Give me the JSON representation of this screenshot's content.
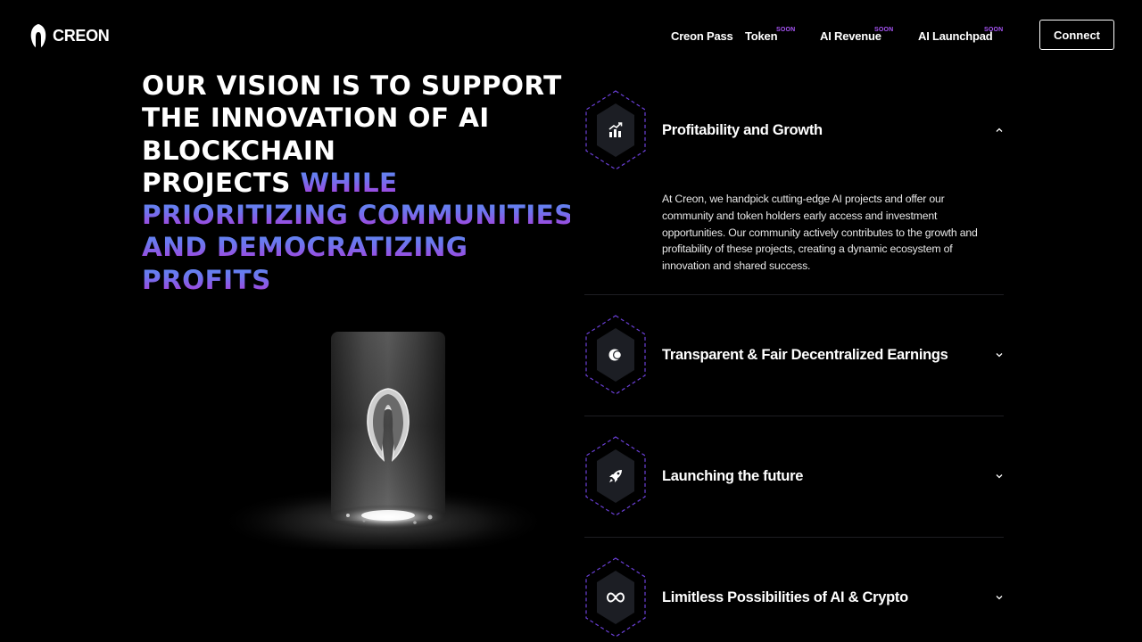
{
  "brand": {
    "name": "CREON"
  },
  "nav": {
    "items": [
      {
        "label": "Creon Pass",
        "badge": ""
      },
      {
        "label": "Token",
        "badge": "SOON"
      },
      {
        "label": "AI Revenue",
        "badge": "SOON"
      },
      {
        "label": "AI Launchpad",
        "badge": "SOON"
      }
    ],
    "connect_label": "Connect"
  },
  "headline": {
    "lines_white": [
      "OUR VISION IS TO SUPPORT",
      "THE INNOVATION OF AI",
      "BLOCKCHAIN",
      "PROJECTS"
    ],
    "highlight_inline": "WHILE",
    "lines_highlight": [
      "PRIORITIZING COMMUNITIES",
      "AND DEMOCRATIZING",
      "PROFITS"
    ]
  },
  "accordion": {
    "items": [
      {
        "title": "Profitability and Growth",
        "icon": "chart-growth-icon",
        "expanded": true,
        "body": "At Creon, we handpick cutting-edge AI projects and offer our community and token holders early access and investment opportunities. Our community actively contributes to the growth and profitability of these projects, creating a dynamic ecosystem of innovation and shared success."
      },
      {
        "title": "Transparent & Fair Decentralized Earnings",
        "icon": "coins-icon",
        "expanded": false
      },
      {
        "title": "Launching the future",
        "icon": "rocket-icon",
        "expanded": false
      },
      {
        "title": "Limitless Possibilities of AI & Crypto",
        "icon": "infinity-icon",
        "expanded": false
      }
    ]
  },
  "colors": {
    "accent": "#a855f7",
    "gradient_start": "#5a8df2",
    "gradient_end": "#a944e0",
    "background": "#000000"
  }
}
